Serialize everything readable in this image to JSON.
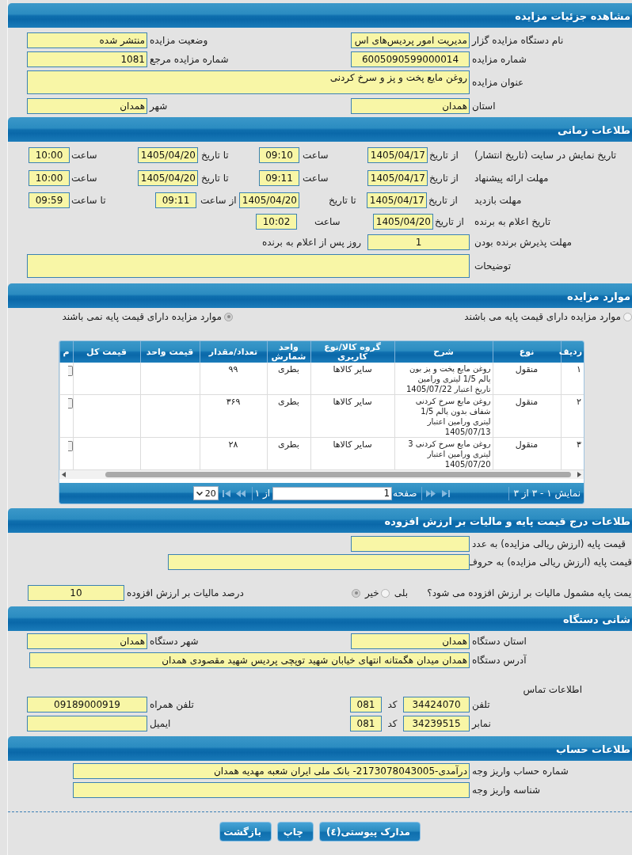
{
  "details": {
    "title": "مشاهده جزئیات مزایده",
    "rows": [
      {
        "fields": [
          {
            "label": "نام دستگاه مزایده گزار",
            "value": "مدیریت امور پردیس‌های اس",
            "kind": "short"
          },
          {
            "label": "وضعیت مزایده",
            "value": "منتشر شده",
            "kind": "short"
          }
        ]
      },
      {
        "fields": [
          {
            "label": "شماره مزایده",
            "value": "6005090599000014",
            "kind": "short"
          },
          {
            "label": "شماره مزایده مرجع",
            "value": "1081",
            "kind": "short"
          }
        ]
      },
      {
        "fields": [
          {
            "label": "عنوان مزایده",
            "value": "روغن مایع پخت و پز و سرخ کردنی",
            "kind": "textarea"
          }
        ]
      },
      {
        "fields": [
          {
            "label": "استان",
            "value": "همدان",
            "kind": "short"
          },
          {
            "label": "شهر",
            "value": "همدان",
            "kind": "short"
          }
        ]
      }
    ]
  },
  "timing": {
    "title": "طلاعات زمانی",
    "rows": [
      {
        "label": "تاریخ نمایش در سایت (تاریخ انتشار)",
        "parts": [
          {
            "kind": "text",
            "text": "از تاریخ"
          },
          {
            "kind": "date",
            "value": "1405/04/17"
          },
          {
            "kind": "text",
            "text": "ساعت"
          },
          {
            "kind": "time",
            "value": "09:10"
          },
          {
            "kind": "text",
            "text": "تا تاریخ"
          },
          {
            "kind": "date",
            "value": "1405/04/20"
          },
          {
            "kind": "text",
            "text": "ساعت"
          },
          {
            "kind": "time",
            "value": "10:00"
          }
        ]
      },
      {
        "label": "مهلت ارائه پیشنهاد",
        "parts": [
          {
            "kind": "text",
            "text": "از تاریخ"
          },
          {
            "kind": "date",
            "value": "1405/04/17"
          },
          {
            "kind": "text",
            "text": "ساعت"
          },
          {
            "kind": "time",
            "value": "09:11"
          },
          {
            "kind": "text",
            "text": "تا تاریخ"
          },
          {
            "kind": "date",
            "value": "1405/04/20"
          },
          {
            "kind": "text",
            "text": "ساعت"
          },
          {
            "kind": "time",
            "value": "10:00"
          }
        ]
      },
      {
        "label": "مهلت بازدید",
        "parts": [
          {
            "kind": "text",
            "text": "از تاریخ"
          },
          {
            "kind": "date",
            "value": "1405/04/17"
          },
          {
            "kind": "text",
            "text": "تا تاریخ"
          },
          {
            "kind": "date",
            "value": "1405/04/20"
          },
          {
            "kind": "text",
            "text": "از ساعت"
          },
          {
            "kind": "time",
            "value": "09:11"
          },
          {
            "kind": "text",
            "text": "تا ساعت"
          },
          {
            "kind": "time",
            "value": "09:59"
          }
        ]
      },
      {
        "label": "تاریخ اعلام به برنده",
        "parts": [
          {
            "kind": "text",
            "text": "از تاریخ"
          },
          {
            "kind": "date",
            "value": "1405/04/20"
          },
          {
            "kind": "text",
            "text": "ساعت"
          },
          {
            "kind": "time",
            "value": "10:02"
          }
        ]
      },
      {
        "label": "مهلت پذیرش برنده بودن",
        "parts": [
          {
            "kind": "number",
            "value": "1"
          },
          {
            "kind": "note",
            "text": "روز پس از اعلام به برنده"
          }
        ]
      },
      {
        "label": "توضیحات",
        "parts": [
          {
            "kind": "textarea"
          }
        ]
      }
    ]
  },
  "items": {
    "title": "موارد مزایده",
    "options": [
      {
        "label": "موارد مزایده دارای قیمت پایه می باشند",
        "selected": false
      },
      {
        "label": "موارد مزایده دارای قیمت پایه نمی باشند",
        "selected": true
      }
    ],
    "table": {
      "columns": [
        "ردیف",
        "نوع",
        "شرح",
        "گروه کالا/نوع کاربری",
        "واحد شمارش",
        "تعداد/مقدار",
        "قیمت واحد",
        "قیمت کل",
        "م"
      ],
      "rows": [
        {
          "cells": [
            "۱",
            "منقول",
            "روغن مایع پخت و پز بون پالم 1/5 لیتری ورامین تاریخ اعتبار 1405/07/22",
            "سایر کالاها",
            "بطری",
            "۹۹"
          ]
        },
        {
          "cells": [
            "۲",
            "منقول",
            "روغن مایع سرخ کردنی شفاف بدون پالم 1/5 لیتری ورامین اعتبار 1405/07/13",
            "سایر کالاها",
            "بطری",
            "۳۶۹"
          ]
        },
        {
          "cells": [
            "۳",
            "منقول",
            "روغن مایع سرخ کردنی 3 لیتری ورامین اعتبار 1405/07/20",
            "سایر کالاها",
            "بطری",
            "۲۸"
          ]
        }
      ]
    },
    "pager": {
      "summary": "نمایش ۱ - ۳ از ۳",
      "page_label": "صفحه",
      "page": "1",
      "page_count": "از ۱",
      "page_size": "20"
    }
  },
  "pricing": {
    "title": "طلاعات درج قیمت پایه و مالیات بر ارزش افزوده",
    "rows": [
      {
        "fields": [
          {
            "label": "قیمت پایه (ارزش ریالی مزایده) به عدد",
            "kind": "short"
          }
        ]
      },
      {
        "fields": [
          {
            "label": "قیمت پایه (ارزش ریالی مزایده) به حروف",
            "kind": "medium"
          }
        ]
      }
    ],
    "vat": {
      "question": "یمت پایه مشمول مالیات بر ارزش افزوده می شود؟",
      "options": [
        {
          "label": "بلی",
          "selected": false
        },
        {
          "label": "خیر",
          "selected": true
        }
      ],
      "rate_label": "درصد مالیات بر ارزش افزوده",
      "rate": "10"
    }
  },
  "address": {
    "title": "شانی دستگاه",
    "rows": [
      {
        "fields": [
          {
            "label": "استان دستگاه",
            "value": "همدان",
            "kind": "short"
          },
          {
            "label": "شهر دستگاه",
            "value": "همدان",
            "kind": "short"
          }
        ]
      },
      {
        "fields": [
          {
            "label": "آدرس دستگاه",
            "value": "همدان میدان هگمتانه انتهای خیابان شهید توپچی پردیس شهید مقصودی همدان",
            "kind": "wide"
          }
        ]
      }
    ],
    "contact_title": "اطلاعات تماس",
    "contacts": [
      {
        "label": "تلفن",
        "value": "34424070",
        "code_label": "کد",
        "code": "081",
        "other_label": "تلفن همراه",
        "other_value": "09189000919"
      },
      {
        "label": "نمابر",
        "value": "34239515",
        "code_label": "کد",
        "code": "081",
        "other_label": "ایمیل"
      }
    ]
  },
  "account": {
    "title": "طلاعات حساب",
    "rows": [
      {
        "fields": [
          {
            "label": "شماره حساب واریز وجه",
            "value": "درآمدی-2173078043005- بانک ملی ایران شعبه مهدیه همدان",
            "kind": "long"
          }
        ]
      },
      {
        "fields": [
          {
            "label": "شناسه واریز وجه",
            "kind": "long"
          }
        ]
      }
    ]
  },
  "buttons": [
    "مدارک پیوستی(٤)",
    "چاپ",
    "بازگشت"
  ]
}
